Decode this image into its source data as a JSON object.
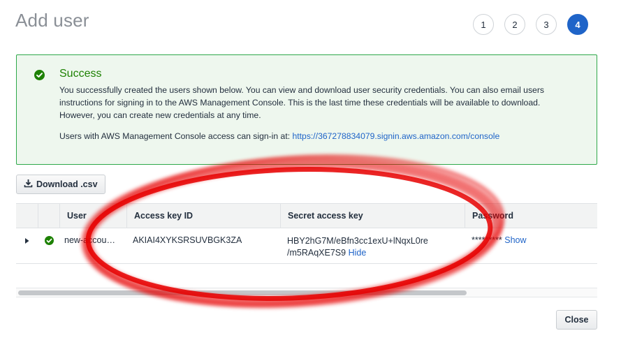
{
  "page": {
    "title": "Add user"
  },
  "steps": [
    "1",
    "2",
    "3",
    "4"
  ],
  "active_step": "4",
  "success": {
    "title": "Success",
    "message": "You successfully created the users shown below. You can view and download user security credentials. You can also email users instructions for signing in to the AWS Management Console. This is the last time these credentials will be available to download. However, you can create new credentials at any time.",
    "console_text": "Users with AWS Management Console access can sign-in at: ",
    "console_url": "https://367278834079.signin.aws.amazon.com/console"
  },
  "toolbar": {
    "download_label": "Download .csv"
  },
  "table": {
    "columns": {
      "user": "User",
      "access_key_id": "Access key ID",
      "secret_access_key": "Secret access key",
      "password": "Password"
    },
    "row": {
      "user": "new-accou…",
      "access_key_id": "AKIAI4XYKSRSUVBGK3ZA",
      "secret_line1": "HBY2hG7M/eBfn3cc1exU+lNqxL0re",
      "secret_line2": "/m5RAqXE7S9",
      "hide_label": "Hide",
      "password_mask": "*********",
      "show_label": "Show"
    }
  },
  "footer": {
    "close_label": "Close"
  },
  "colors": {
    "accent": "#1f64c8",
    "success": "#1d8102",
    "annotation": "#e60000"
  }
}
